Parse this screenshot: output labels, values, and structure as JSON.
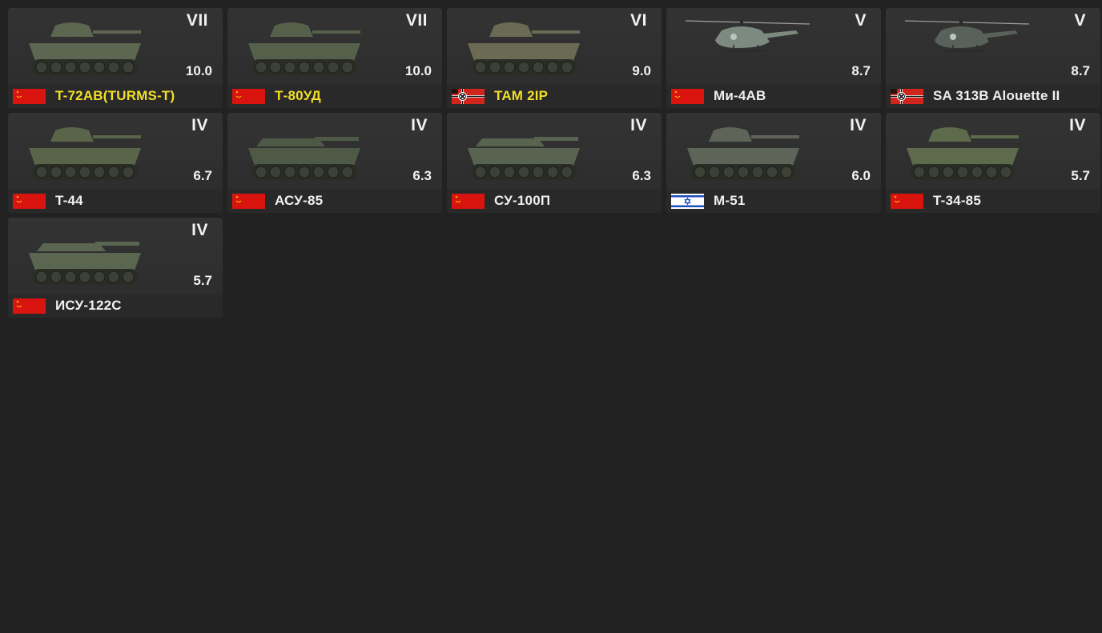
{
  "vehicles": [
    {
      "rank": "VII",
      "br": "10.0",
      "name": "T-72AB(TURMS-T)",
      "nation": "ussr",
      "premium": true,
      "kind": "tank-mbt"
    },
    {
      "rank": "VII",
      "br": "10.0",
      "name": "Т-80УД",
      "nation": "ussr",
      "premium": true,
      "kind": "tank-mbt"
    },
    {
      "rank": "VI",
      "br": "9.0",
      "name": "TAM 2IP",
      "nation": "germany",
      "premium": true,
      "kind": "tank-mbt"
    },
    {
      "rank": "V",
      "br": "8.7",
      "name": "Ми-4АВ",
      "nation": "ussr",
      "premium": false,
      "kind": "helicopter"
    },
    {
      "rank": "V",
      "br": "8.7",
      "name": "SA 313B Alouette II",
      "nation": "germany",
      "premium": false,
      "kind": "helicopter"
    },
    {
      "rank": "IV",
      "br": "6.7",
      "name": "T-44",
      "nation": "ussr",
      "premium": false,
      "kind": "tank-medium"
    },
    {
      "rank": "IV",
      "br": "6.3",
      "name": "АСУ-85",
      "nation": "ussr",
      "premium": false,
      "kind": "tank-spg"
    },
    {
      "rank": "IV",
      "br": "6.3",
      "name": "СУ-100П",
      "nation": "ussr",
      "premium": false,
      "kind": "tank-spg"
    },
    {
      "rank": "IV",
      "br": "6.0",
      "name": "M-51",
      "nation": "israel",
      "premium": false,
      "kind": "tank-medium"
    },
    {
      "rank": "IV",
      "br": "5.7",
      "name": "T-34-85",
      "nation": "ussr",
      "premium": false,
      "kind": "tank-medium"
    },
    {
      "rank": "IV",
      "br": "5.7",
      "name": "ИСУ-122С",
      "nation": "ussr",
      "premium": false,
      "kind": "tank-spg"
    }
  ],
  "colors": {
    "background": "#222222",
    "card": "#2f2f2f",
    "premium_text": "#f2df2a",
    "normal_text": "#f0f0f0",
    "ussr_red": "#d9140f",
    "israel_blue": "#1f4fbf"
  }
}
